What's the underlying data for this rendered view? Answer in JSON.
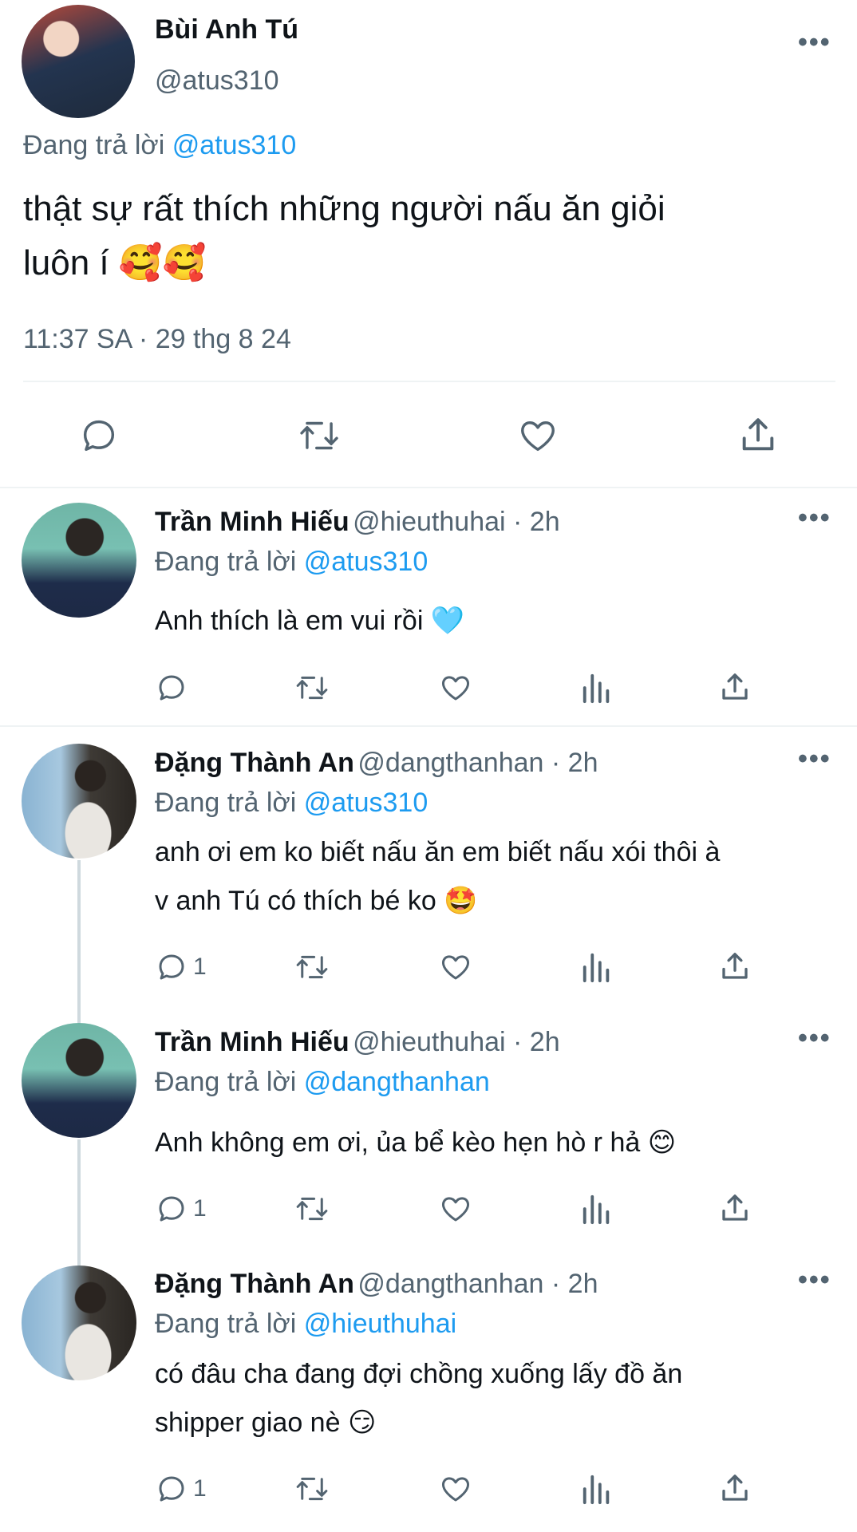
{
  "main_tweet": {
    "author_name": "Bùi Anh Tú",
    "author_handle": "@atus310",
    "reply_prefix": "Đang trả lời",
    "reply_to": "@atus310",
    "text_line1": "thật sự rất thích những người nấu ăn giỏi",
    "text_line2": "luôn í 🥰🥰",
    "timestamp": "11:37 SA · 29 thg 8 24",
    "more": "•••"
  },
  "replies": [
    {
      "author_name": "Trần Minh Hiếu",
      "meta": "@hieuthuhai · 2h",
      "reply_prefix": "Đang trả lời",
      "reply_to": "@atus310",
      "text_line1": "Anh thích là em vui rồi 🩵",
      "reply_count": "",
      "more": "•••"
    },
    {
      "author_name": "Đặng Thành An",
      "meta": "@dangthanhan · 2h",
      "reply_prefix": "Đang trả lời",
      "reply_to": "@atus310",
      "text_line1": "anh ơi em ko biết nấu ăn em biết nấu xói thôi à",
      "text_line2": "v anh Tú có thích bé ko 🤩",
      "reply_count": "1",
      "more": "•••"
    },
    {
      "author_name": "Trần Minh Hiếu",
      "meta": "@hieuthuhai · 2h",
      "reply_prefix": "Đang trả lời",
      "reply_to": "@dangthanhan",
      "text_line1": "Anh không em ơi, ủa bể kèo hẹn hò r hả 😊",
      "reply_count": "1",
      "more": "•••"
    },
    {
      "author_name": "Đặng Thành An",
      "meta": "@dangthanhan · 2h",
      "reply_prefix": "Đang trả lời",
      "reply_to": "@hieuthuhai",
      "text_line1": "có đâu cha đang đợi chồng xuống lấy đồ ăn",
      "text_line2": "shipper giao nè 😏",
      "reply_count": "1",
      "more": "•••"
    }
  ],
  "colors": {
    "accent": "#1d9bf0",
    "secondary_text": "#536471",
    "primary_text": "#0f1419",
    "divider": "#eff3f4"
  }
}
